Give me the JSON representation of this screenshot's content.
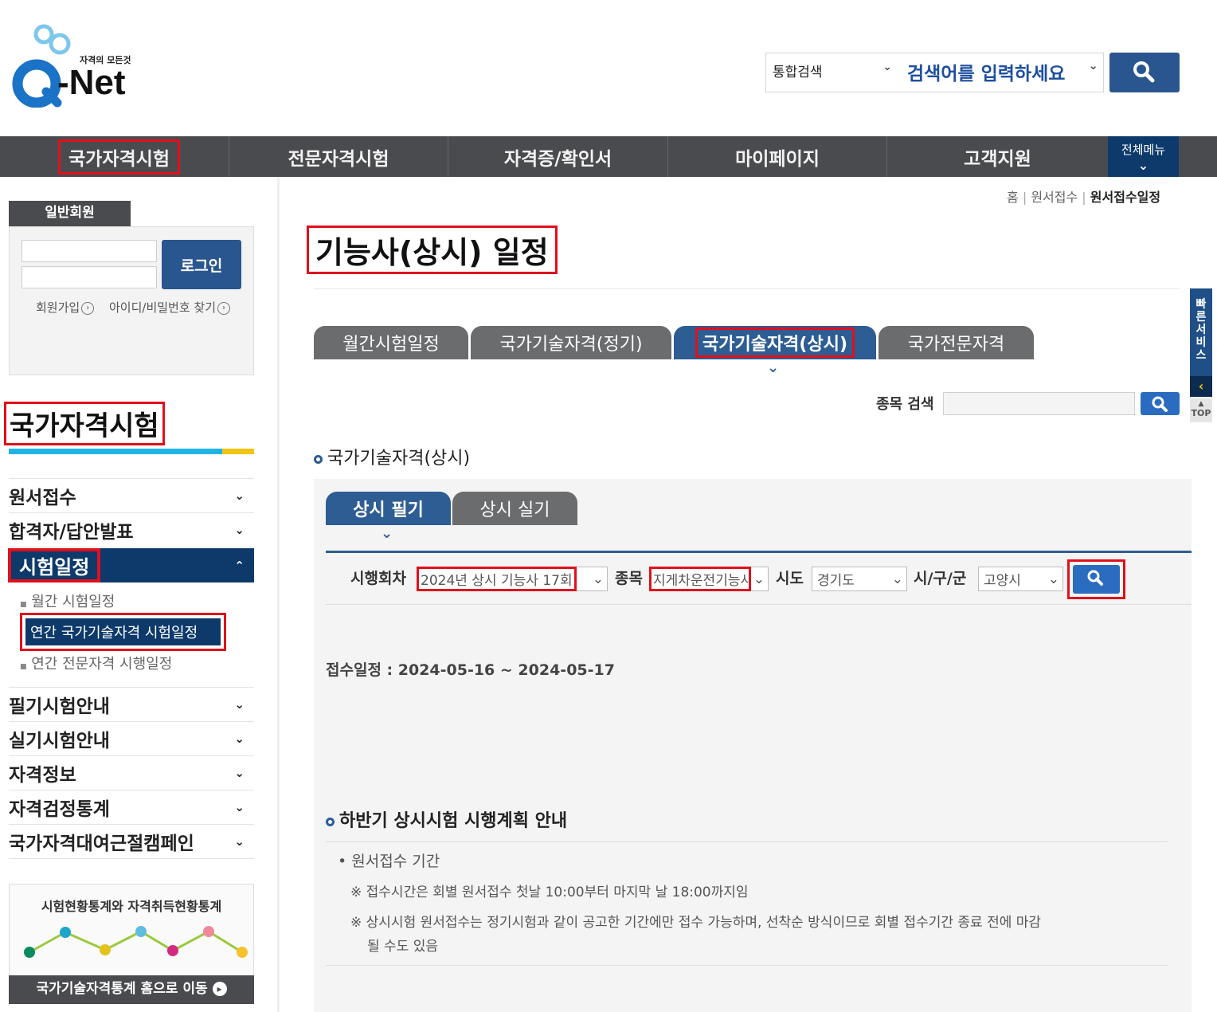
{
  "header": {
    "logo_small": "자격의 모든것",
    "logo_main": "-Net",
    "search_scope": "통합검색",
    "search_placeholder": "검색어를 입력하세요"
  },
  "gnb": {
    "items": [
      "국가자격시험",
      "전문자격시험",
      "자격증/확인서",
      "마이페이지",
      "고객지원"
    ],
    "all_menu": "전체메뉴"
  },
  "login": {
    "tab": "일반회원",
    "button": "로그인",
    "signup": "회원가입",
    "find": "아이디/비밀번호 찾기"
  },
  "lnb": {
    "title": "국가자격시험",
    "items": [
      "원서접수",
      "합격자/답안발표",
      "시험일정",
      "필기시험안내",
      "실기시험안내",
      "자격정보",
      "자격검정통계",
      "국가자격대여근절캠페인"
    ],
    "sub_items": [
      "월간 시험일정",
      "연간 국가기술자격 시험일정",
      "연간 전문자격 시행일정"
    ]
  },
  "banner": {
    "title": "시험현황통계와 자격취득현황통계",
    "link": "국가기술자격통계 홈으로 이동"
  },
  "breadcrumb": {
    "home": "홈",
    "level1": "원서접수",
    "current": "원서접수일정"
  },
  "main": {
    "title": "기능사(상시) 일정",
    "tabs": [
      "월간시험일정",
      "국가기술자격(정기)",
      "국가기술자격(상시)",
      "국가전문자격"
    ],
    "item_search_label": "종목 검색",
    "section_title": "국가기술자격(상시)",
    "subtabs": [
      "상시 필기",
      "상시 실기"
    ],
    "filters": {
      "round_label": "시행회차",
      "round_value": "2024년 상시 기능사 17회",
      "item_label": "종목",
      "item_value": "지게차운전기능사",
      "sido_label": "시도",
      "sido_value": "경기도",
      "sigungu_label": "시/구/군",
      "sigungu_value": "고양시"
    },
    "schedule": "접수일정 : 2024-05-16 ~ 2024-05-17",
    "plan_title": "하반기 상시시험 시행계획 안내",
    "plan_bullet": "원서접수 기간",
    "plan_notes": [
      "※ 접수시간은 회별 원서접수 첫날 10:00부터 마지막 날 18:00까지임",
      "※ 상시시험 원서접수는 정기시험과 같이 공고한 기간에만 접수 가능하며, 선착순 방식이므로 회별 접수기간 종료 전에 마감",
      "될 수도 있음"
    ]
  },
  "quick": {
    "label": "빠른서비스",
    "top": "TOP"
  }
}
